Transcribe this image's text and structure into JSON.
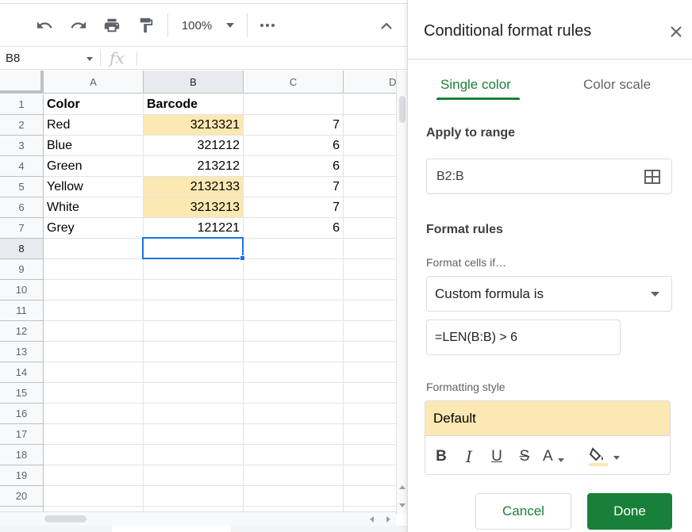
{
  "toolbar": {
    "zoom": "100%",
    "icons": [
      "undo-icon",
      "redo-icon",
      "print-icon",
      "paint-format-icon",
      "more-icon",
      "collapse-icon"
    ]
  },
  "formula_bar": {
    "cell_ref": "B8",
    "fx_label": "fx"
  },
  "sheet": {
    "columns": [
      "A",
      "B",
      "C",
      "D"
    ],
    "rows": [
      "1",
      "2",
      "3",
      "4",
      "5",
      "6",
      "7",
      "8",
      "9",
      "10",
      "11",
      "12",
      "13",
      "14",
      "15",
      "16",
      "17",
      "18",
      "19",
      "20"
    ],
    "cells": {
      "a1": "Color",
      "b1": "Barcode",
      "a2": "Red",
      "b2": "3213321",
      "c2": "7",
      "a3": "Blue",
      "b3": "321212",
      "c3": "6",
      "a4": "Green",
      "b4": "213212",
      "c4": "6",
      "a5": "Yellow",
      "b5": "2132133",
      "c5": "7",
      "a6": "White",
      "b6": "3213213",
      "c6": "7",
      "a7": "Grey",
      "b7": "121221",
      "c7": "6"
    },
    "highlight_color": "#fce8b2",
    "selected_cell": "B8"
  },
  "panel": {
    "title": "Conditional format rules",
    "tabs": {
      "single": "Single color",
      "scale": "Color scale"
    },
    "apply_range_title": "Apply to range",
    "range_value": "B2:B",
    "format_rules_title": "Format rules",
    "format_cells_if": "Format cells if…",
    "condition": "Custom formula is",
    "formula": "=LEN(B:B) > 6",
    "formatting_style_label": "Formatting style",
    "style_preview": "Default",
    "style_fill_color": "#fce8b2",
    "cancel": "Cancel",
    "done": "Done",
    "accent_color": "#188038"
  }
}
